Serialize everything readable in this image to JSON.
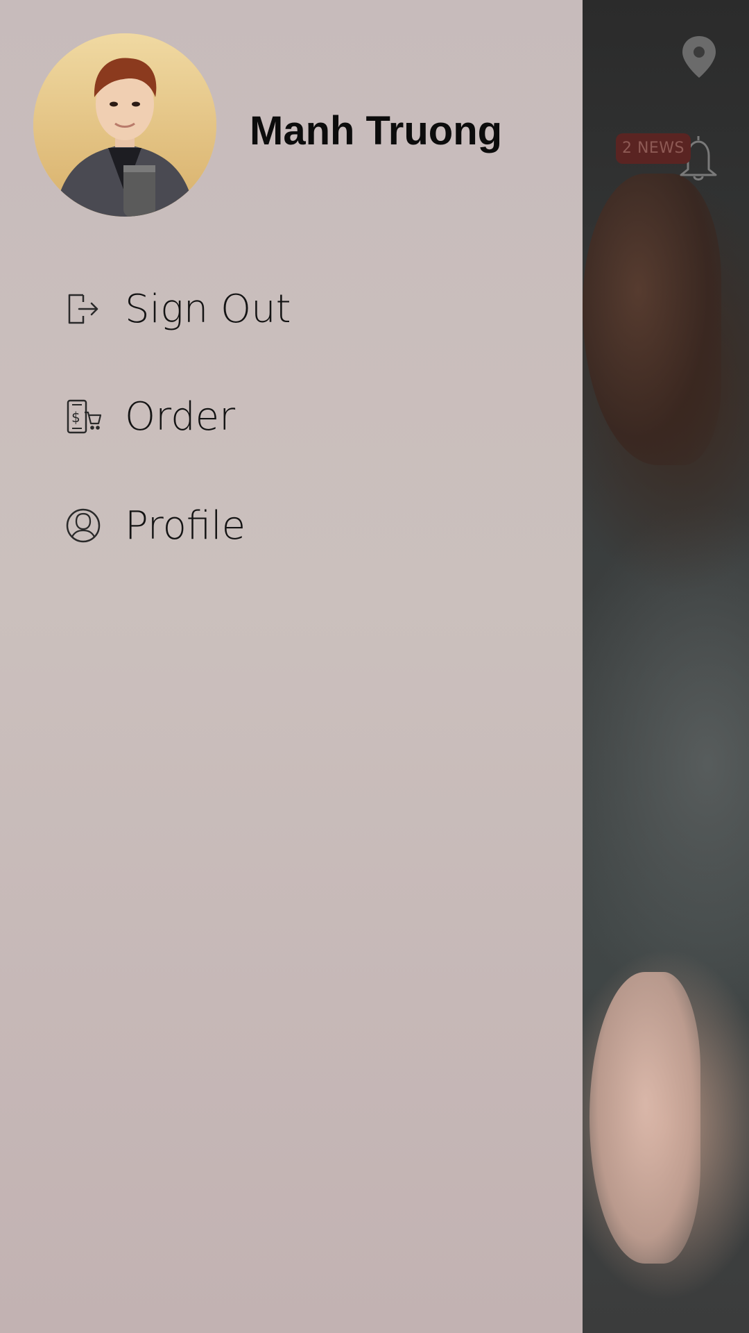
{
  "user": {
    "name": "Manh Truong",
    "avatar_alt": "Profile photo"
  },
  "menu": {
    "items": [
      {
        "label": "Sign Out",
        "icon": "sign-out-icon"
      },
      {
        "label": "Order",
        "icon": "order-cart-icon"
      },
      {
        "label": "Profile",
        "icon": "profile-icon"
      }
    ]
  },
  "topbar": {
    "location_icon": "location-pin-icon",
    "notifications_icon": "bell-icon",
    "news_badge": "2 NEWS"
  },
  "colors": {
    "drawer_bg": "#c7bbbb",
    "badge_bg": "#5a2422",
    "text": "#141414"
  }
}
